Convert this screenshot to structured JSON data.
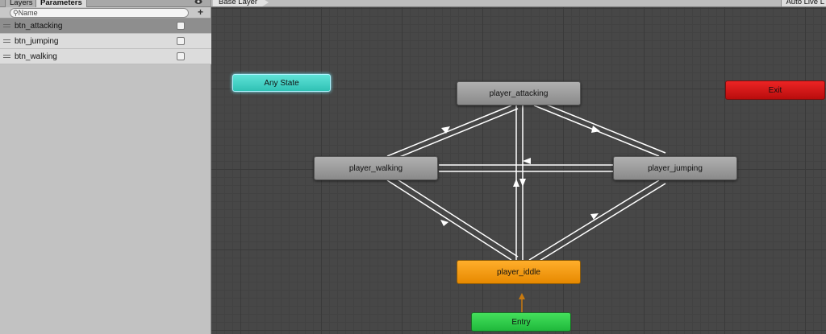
{
  "left_panel": {
    "tabs": {
      "layers": "Layers",
      "parameters": "Parameters"
    },
    "search": {
      "placeholder": "Name"
    },
    "add_button": "+",
    "parameters": [
      {
        "name": "btn_attacking",
        "value": false
      },
      {
        "name": "btn_jumping",
        "value": false
      },
      {
        "name": "btn_walking",
        "value": false
      }
    ]
  },
  "graph": {
    "breadcrumb": "Base Layer",
    "auto_live": "Auto Live L",
    "states": {
      "any_state": "Any State",
      "exit": "Exit",
      "attacking": "player_attacking",
      "walking": "player_walking",
      "jumping": "player_jumping",
      "idle": "player_iddle",
      "entry": "Entry"
    },
    "colors": {
      "any_state": "#3fd2c6",
      "exit": "#d21919",
      "default": "#9e9e9e",
      "idle_default": "#f39a14",
      "entry": "#2ecc47",
      "transition": "#ffffff",
      "entry_transition": "#c87a10"
    }
  }
}
